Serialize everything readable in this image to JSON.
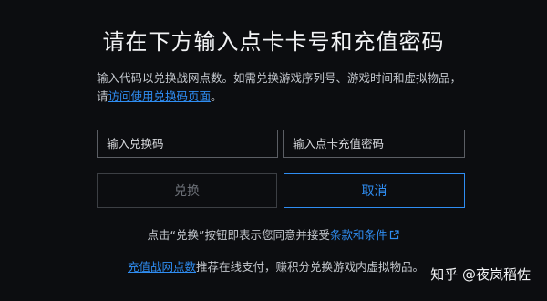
{
  "title": "请在下方输入点卡卡号和充值密码",
  "description": {
    "text": "输入代码以兑换战网点数。如需兑换游戏序列号、游戏时间和虚拟物品，请",
    "link": "访问使用兑换码页面",
    "end": "。"
  },
  "inputs": {
    "code_placeholder": "输入兑换码",
    "card_password_placeholder": "输入点卡充值密码"
  },
  "buttons": {
    "redeem": "兑换",
    "cancel": "取消"
  },
  "terms": {
    "prefix": "点击“兑换”按钮即表示您同意并接受",
    "link": "条款和条件"
  },
  "footer": {
    "link": "充值战网点数",
    "text": "推荐在线支付，赚积分兑换游戏内虚拟物品。"
  },
  "watermark": "知乎 @夜岚稻佐",
  "colors": {
    "background": "#0c0d10",
    "accent": "#2f8df2"
  }
}
